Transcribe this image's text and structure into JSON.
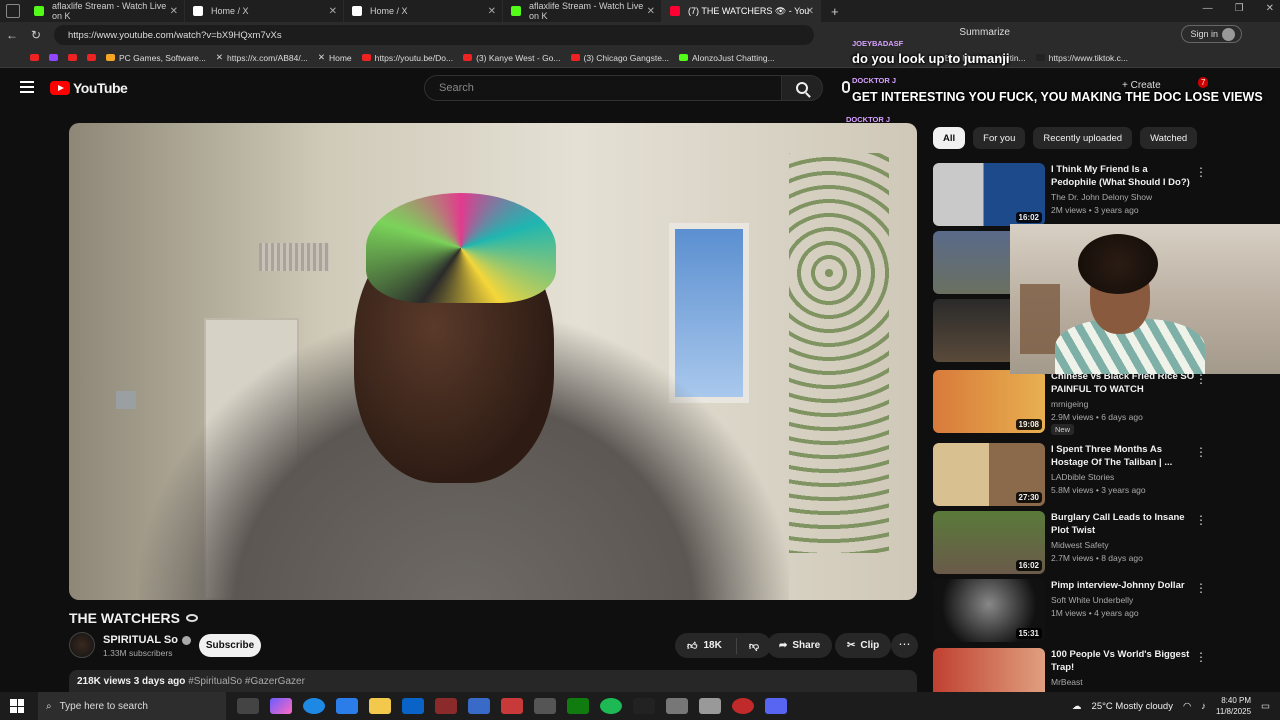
{
  "browser": {
    "tabs": [
      {
        "label": "aflaxlife Stream - Watch Live on K",
        "color": "#53fc18"
      },
      {
        "label": "Home / X",
        "color": "#ffffff"
      },
      {
        "label": "Home / X",
        "color": "#ffffff"
      },
      {
        "label": "aflaxlife Stream - Watch Live on K",
        "color": "#53fc18"
      },
      {
        "label": "(7) THE WATCHERS 👁 - You",
        "color": "#ff0033"
      }
    ],
    "url": "https://www.youtube.com/watch?v=bX9HQxm7vXs",
    "summarize_label": "Summarize",
    "signin_label": "Sign in",
    "bookmarks": [
      "PC Games, Software...",
      "https://x.com/AB84/...",
      "Home",
      "https://youtu.be/Do...",
      "(3) Kanye West - Go...",
      "(3) Chicago Gangste...",
      "AlonzoJust Chatting...",
      "Bob Marley - Waitin...",
      "https://www.tiktok.c..."
    ]
  },
  "youtube": {
    "logo_text": "YouTube",
    "search_placeholder": "Search",
    "create_label": "Create",
    "notifications_count": "7",
    "video": {
      "title": "THE WATCHERS",
      "channel": "SPIRITUAL So",
      "subscribers": "1.33M subscribers",
      "subscribe_label": "Subscribe",
      "likes": "18K",
      "share_label": "Share",
      "clip_label": "Clip",
      "views_meta": "218K views  3 days ago",
      "tags": "#SpiritualSo #GazerGazer"
    },
    "chips": [
      "All",
      "For you",
      "Recently uploaded",
      "Watched"
    ],
    "recommendations": [
      {
        "title": "I Think My Friend Is a Pedophile (What Should I Do?)",
        "channel": "The Dr. John Delony Show",
        "meta": "2M views • 3 years ago",
        "duration": "16:02",
        "thumb": "#1d4a8a"
      },
      {
        "title": "",
        "channel": "",
        "meta": "",
        "duration": "",
        "thumb": "#6a7060"
      },
      {
        "title": "",
        "channel": "",
        "meta": "",
        "duration": "",
        "thumb": "#3a3530"
      },
      {
        "title": "Chinese vs Black Fried Rice SO PAINFUL TO WATCH",
        "channel": "mrnigeing",
        "meta": "2.9M views • 6 days ago",
        "duration": "19:08",
        "thumb": "#c86a2a",
        "badge": "New"
      },
      {
        "title": "I Spent Three Months As Hostage Of The Taliban | ...",
        "channel": "LADbible Stories",
        "meta": "5.8M views • 3 years ago",
        "duration": "27:30",
        "thumb": "#8a6a4a"
      },
      {
        "title": "Burglary Call Leads to Insane Plot Twist",
        "channel": "Midwest Safety",
        "meta": "2.7M views • 8 days ago",
        "duration": "16:02",
        "thumb": "#6a5a4a"
      },
      {
        "title": "Pimp interview-Johnny Dollar",
        "channel": "Soft White Underbelly",
        "meta": "1M views • 4 years ago",
        "duration": "15:31",
        "thumb": "#444444"
      },
      {
        "title": "100 People Vs World's Biggest Trap!",
        "channel": "MrBeast",
        "meta": "",
        "duration": "",
        "thumb": "#aa3a2a"
      }
    ]
  },
  "stream_overlay": {
    "chat": [
      {
        "user": "JOEYBADASF",
        "message": "do you look up to jumanji"
      },
      {
        "user": "DOCKTOR J",
        "message": "GET INTERESTING YOU FUCK, YOU MAKING THE DOC LOSE VIEWS"
      },
      {
        "user": "DOCKTOR J",
        "message": ""
      }
    ]
  },
  "taskbar": {
    "search_placeholder": "Type here to search",
    "weather": "25°C  Mostly cloudy",
    "time": "8:40 PM",
    "date": "11/8/2025"
  }
}
